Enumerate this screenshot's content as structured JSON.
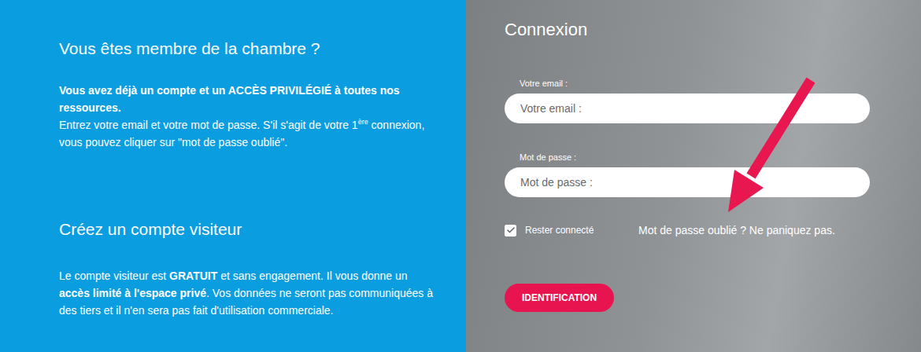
{
  "member_section": {
    "title": "Vous êtes membre de la chambre ?",
    "paragraph": [
      {
        "text": "Vous avez déjà un compte et un ACCÈS PRIVILÉGIÉ à toutes nos ressources.",
        "bold": true,
        "sup": false,
        "break": true
      },
      {
        "text": "Entrez votre email et votre mot de passe. S'il s'agit de votre ",
        "bold": false,
        "sup": false,
        "break": false
      },
      {
        "text": "1",
        "bold": false,
        "sup": false,
        "break": false
      },
      {
        "text": "ère",
        "bold": false,
        "sup": true,
        "break": false
      },
      {
        "text": " connexion, vous pouvez cliquer sur \"mot de passe oublié\".",
        "bold": false,
        "sup": false,
        "break": false
      }
    ]
  },
  "visitor_section": {
    "title": "Créez un compte visiteur",
    "paragraph": [
      {
        "text": "Le compte visiteur est ",
        "bold": false,
        "sup": false,
        "break": false
      },
      {
        "text": "GRATUIT",
        "bold": true,
        "sup": false,
        "break": false
      },
      {
        "text": " et sans engagement. Il vous donne un ",
        "bold": false,
        "sup": false,
        "break": false
      },
      {
        "text": "accès limité à l'espace privé",
        "bold": true,
        "sup": false,
        "break": false
      },
      {
        "text": ". Vos données ne seront pas communiquées à des tiers et il n'en sera pas fait d'utilisation commerciale.",
        "bold": false,
        "sup": false,
        "break": false
      }
    ]
  },
  "login": {
    "title": "Connexion",
    "fields": [
      {
        "label": "Votre email :",
        "placeholder": "Votre email :",
        "type": "email"
      },
      {
        "label": "Mot de passe :",
        "placeholder": "Mot de passe :",
        "type": "password"
      }
    ],
    "remember": {
      "label": "Rester connecté",
      "checked": true
    },
    "forgot_link": "Mot de passe oublié ? Ne paniquez pas.",
    "submit": "IDENTIFICATION"
  }
}
